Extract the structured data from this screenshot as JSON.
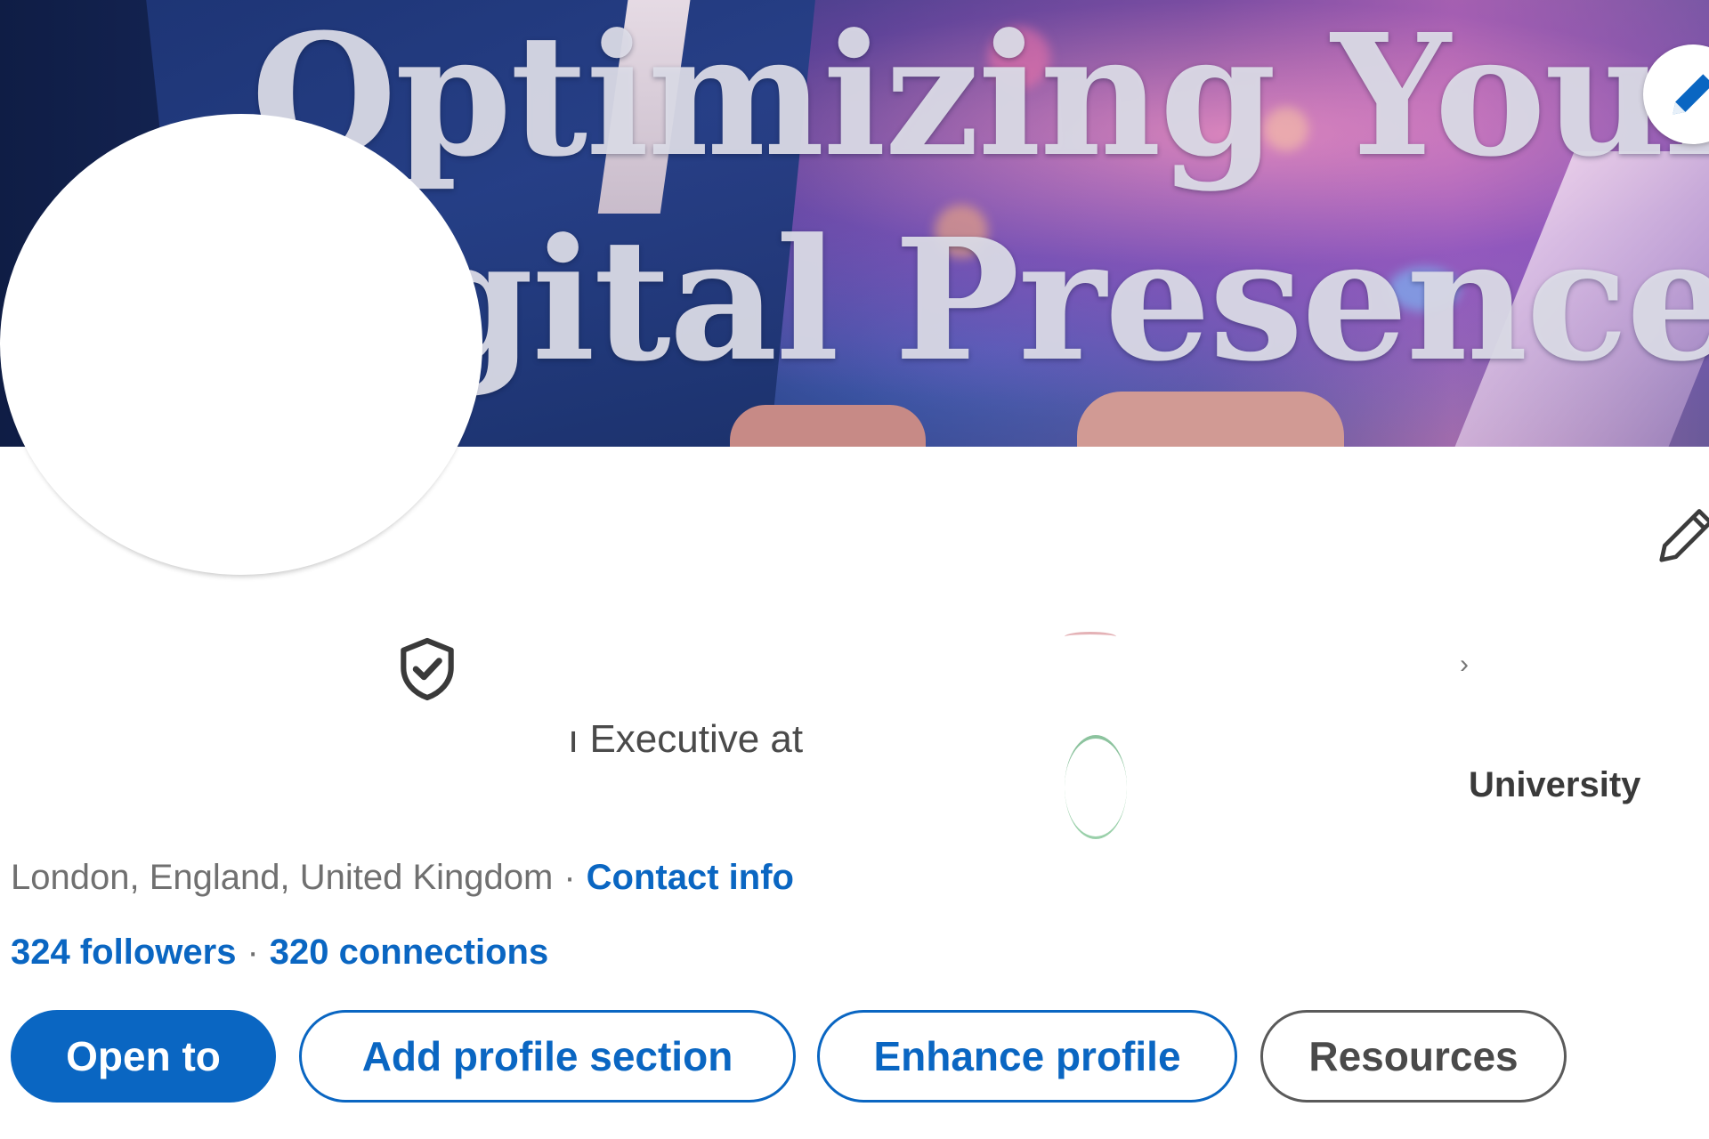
{
  "banner": {
    "title_line1": "Optimizing Your",
    "title_line2": "gital Presence",
    "edit_icon": "pencil-icon"
  },
  "avatar": {
    "icon": "profile-photo"
  },
  "intro": {
    "edit_icon": "pencil-icon"
  },
  "profile": {
    "verified_icon": "shield-check-icon",
    "headline_fragment": "ı Executive at",
    "education_fragment": "University",
    "location": "London, England, United Kingdom",
    "separator": "·",
    "contact_info_label": "Contact info",
    "followers_label": "324 followers",
    "connections_label": "320 connections"
  },
  "actions": {
    "open_to_label": "Open to",
    "add_section_label": "Add profile section",
    "enhance_label": "Enhance profile",
    "resources_label": "Resources"
  },
  "colors": {
    "accent": "#0a66c2",
    "muted_text": "#707070",
    "body_text": "#4a4a4a"
  }
}
